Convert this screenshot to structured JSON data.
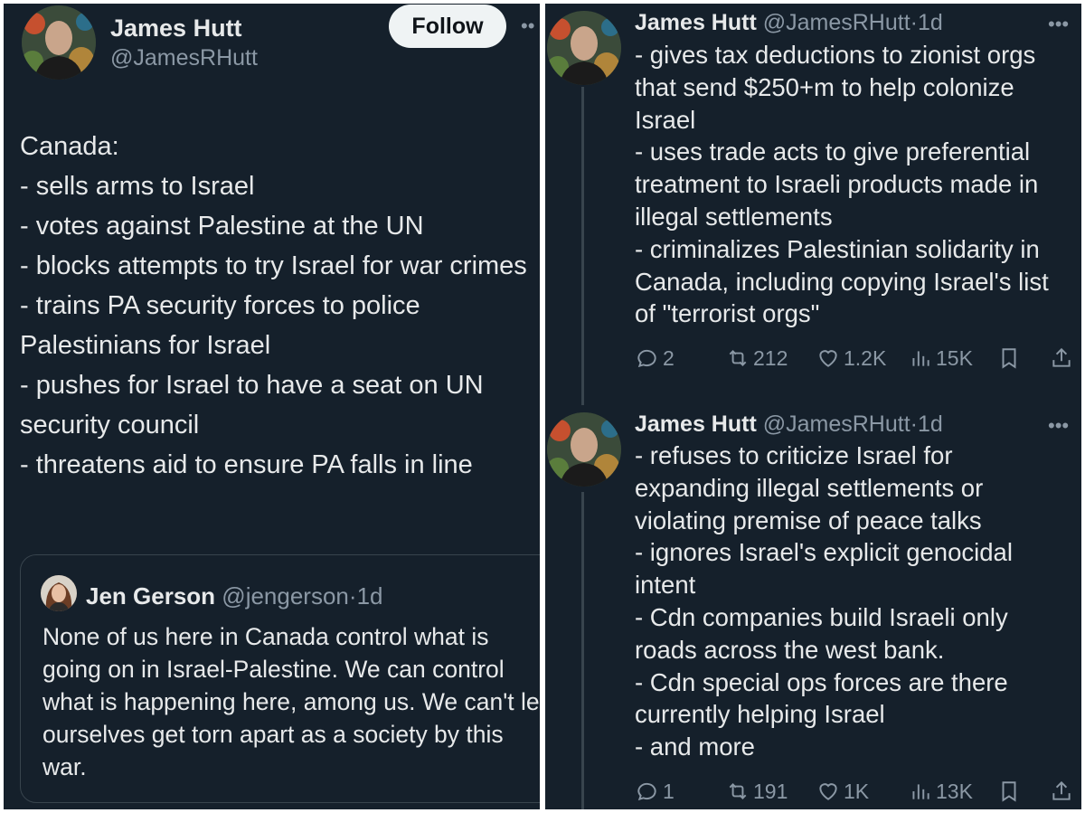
{
  "left": {
    "author_name": "James Hutt",
    "author_handle": "@JamesRHutt",
    "follow_label": "Follow",
    "more_label": "••",
    "body_lines": [
      "Canada:",
      "- sells arms to Israel",
      "- votes against Palestine at the UN",
      "- blocks attempts to try Israel for war crimes",
      "- trains PA security forces to police Palestinians for Israel",
      "- pushes for Israel to have a seat on UN security council",
      "- threatens aid to ensure PA falls in line"
    ],
    "quote": {
      "author_name": "Jen Gerson",
      "author_handle": "@jengerson",
      "separator": "·",
      "time": "1d",
      "text": "None of us here in Canada control what is going on in Israel-Palestine. We can control what is happening here, among us. We can't let ourselves get torn apart as a society by this war."
    }
  },
  "right": {
    "tweets": [
      {
        "author_name": "James Hutt",
        "author_handle": "@JamesRHutt",
        "separator": "·",
        "time": "1d",
        "more_label": "•••",
        "body_lines": [
          "- gives tax deductions to zionist orgs that send $250+m to help colonize Israel",
          "- uses trade acts to give preferential treatment to Israeli products made in illegal settlements",
          "- criminalizes Palestinian solidarity in Canada, including copying Israel's list of \"terrorist orgs\""
        ],
        "replies": "2",
        "reposts": "212",
        "likes": "1.2K",
        "views": "15K"
      },
      {
        "author_name": "James Hutt",
        "author_handle": "@JamesRHutt",
        "separator": "·",
        "time": "1d",
        "more_label": "•••",
        "body_lines": [
          "- refuses to criticize Israel for expanding illegal settlements or violating premise of peace talks",
          "- ignores Israel's explicit genocidal intent",
          "- Cdn companies build Israeli only roads across the west bank.",
          "- Cdn special ops forces are there currently helping Israel",
          "- and more"
        ],
        "replies": "1",
        "reposts": "191",
        "likes": "1K",
        "views": "13K"
      }
    ]
  },
  "icons": {
    "reply": "reply-icon",
    "repost": "repost-icon",
    "like": "heart-icon",
    "views": "views-icon",
    "bookmark": "bookmark-icon",
    "share": "share-icon"
  }
}
